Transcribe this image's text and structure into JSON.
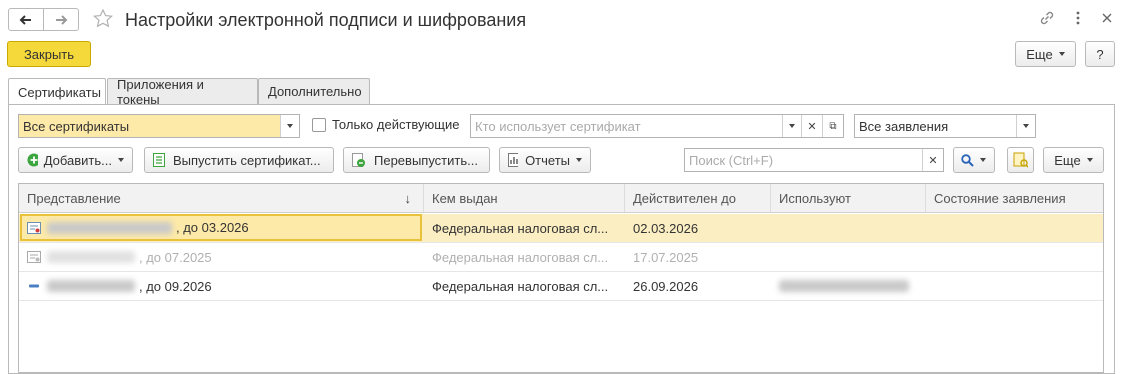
{
  "window": {
    "title": "Настройки электронной подписи и шифрования"
  },
  "toolbar": {
    "close_label": "Закрыть",
    "more_label": "Еще",
    "help_label": "?"
  },
  "tabs": [
    {
      "label": "Сертификаты",
      "active": true
    },
    {
      "label": "Приложения и токены",
      "active": false
    },
    {
      "label": "Дополнительно",
      "active": false
    }
  ],
  "filters": {
    "certificates_select": "Все сертификаты",
    "only_valid_label": "Только действующие",
    "user_placeholder": "Кто использует сертификат",
    "applications_select": "Все заявления"
  },
  "actions": {
    "add_label": "Добавить...",
    "issue_label": "Выпустить сертификат...",
    "reissue_label": "Перевыпустить...",
    "reports_label": "Отчеты",
    "search_placeholder": "Поиск (Ctrl+F)",
    "more_label": "Еще"
  },
  "table": {
    "columns": [
      "Представление",
      "Кем выдан",
      "Действителен до",
      "Используют",
      "Состояние заявления"
    ],
    "sort_indicator": "↓",
    "rows": [
      {
        "presentation": ", до 03.2026",
        "issuer": "Федеральная налоговая сл...",
        "valid_until": "02.03.2026",
        "used_by": "",
        "state": "",
        "selected": true,
        "expired": false
      },
      {
        "presentation": ", до 07.2025",
        "issuer": "Федеральная налоговая сл...",
        "valid_until": "17.07.2025",
        "used_by": "",
        "state": "",
        "selected": false,
        "expired": true
      },
      {
        "presentation": ", до 09.2026",
        "issuer": "Федеральная налоговая сл...",
        "valid_until": "26.09.2026",
        "used_by": "",
        "state": "",
        "selected": false,
        "expired": false
      }
    ]
  },
  "colors": {
    "accent_yellow": "#f5d83a",
    "selected_row": "#fbeec3",
    "filter_highlight": "#fde9a8"
  }
}
